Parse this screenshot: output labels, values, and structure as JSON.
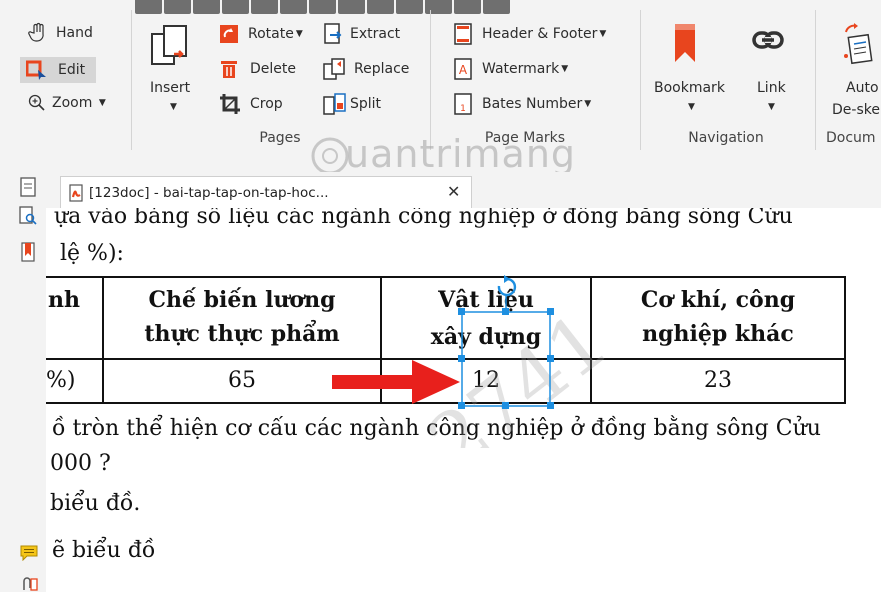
{
  "ribbon": {
    "tools": {
      "hand": "Hand",
      "edit": "Edit",
      "zoom": "Zoom"
    },
    "pages": {
      "insert": "Insert",
      "rotate": "Rotate",
      "extract": "Extract",
      "delete": "Delete",
      "replace": "Replace",
      "crop": "Crop",
      "split": "Split",
      "group": "Pages"
    },
    "page_marks": {
      "header_footer": "Header & Footer",
      "watermark": "Watermark",
      "bates": "Bates Number",
      "group": "Page Marks"
    },
    "navigation": {
      "bookmark": "Bookmark",
      "link": "Link",
      "group": "Navigation"
    },
    "document": {
      "auto": "Auto",
      "deskew": "De-ske",
      "group": "Docum"
    }
  },
  "watermark_text": "uantrimang",
  "tab": {
    "title": "[123doc] - bai-tap-tap-on-tap-hoc...",
    "close": "✕"
  },
  "document": {
    "line1": "ựa vào bảng số liệu các ngành công nghiệp ở đồng bằng sông Cửu",
    "line2": "lệ %):",
    "table": {
      "header": [
        "nh",
        "Chế biến lương",
        "thực thực phẩm",
        "Vật liệu",
        "xây dựng",
        "Cơ khí, công",
        "nghiệp khác"
      ],
      "row": [
        "%)",
        "65",
        "12",
        "23"
      ]
    },
    "line3": "ồ tròn thể hiện cơ cấu các ngành công nghiệp ở đồng bằng sông Cửu",
    "line4": "000 ?",
    "line5": "biểu đồ.",
    "line6": "ẽ biểu đồ"
  },
  "colors": {
    "accent": "#e8451e",
    "selection": "#1e8fe0",
    "arrow": "#e8201c"
  }
}
